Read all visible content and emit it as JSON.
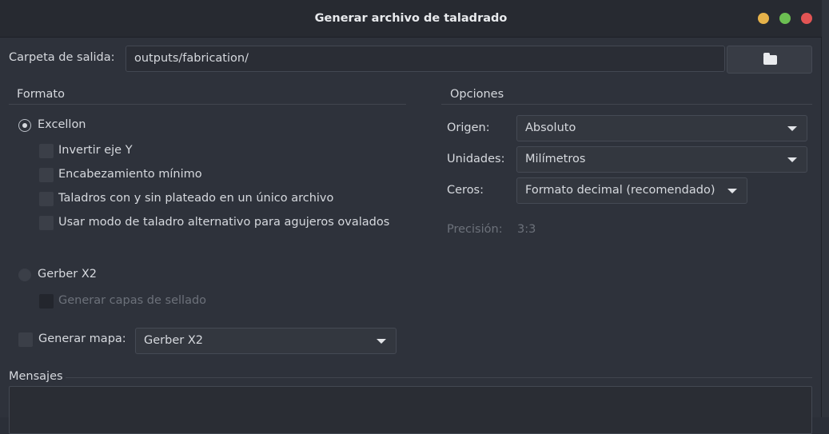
{
  "window": {
    "title": "Generar archivo de taladrado"
  },
  "output": {
    "label": "Carpeta de salida:",
    "value": "outputs/fabrication/"
  },
  "format": {
    "title": "Formato",
    "excellon_label": "Excellon",
    "options": [
      "Invertir eje Y",
      "Encabezamiento mínimo",
      "Taladros con y sin plateado en un único archivo",
      "Usar modo de taladro alternativo para agujeros ovalados"
    ],
    "gerber_label": "Gerber X2",
    "gerber_option": "Generar capas de sellado",
    "map_label": "Generar mapa:",
    "map_value": "Gerber X2"
  },
  "options": {
    "title": "Opciones",
    "origin_label": "Origen:",
    "origin_value": "Absoluto",
    "units_label": "Unidades:",
    "units_value": "Milímetros",
    "zeros_label": "Ceros:",
    "zeros_value": "Formato decimal (recomendado)",
    "precision_label": "Precisión:",
    "precision_value": "3:3"
  },
  "messages": {
    "title": "Mensajes"
  },
  "colors": {
    "titlebar": "#272a31",
    "panel": "#2e323b",
    "close": "#e25454",
    "minimize": "#e6b24a",
    "maximize": "#6cbf52"
  }
}
